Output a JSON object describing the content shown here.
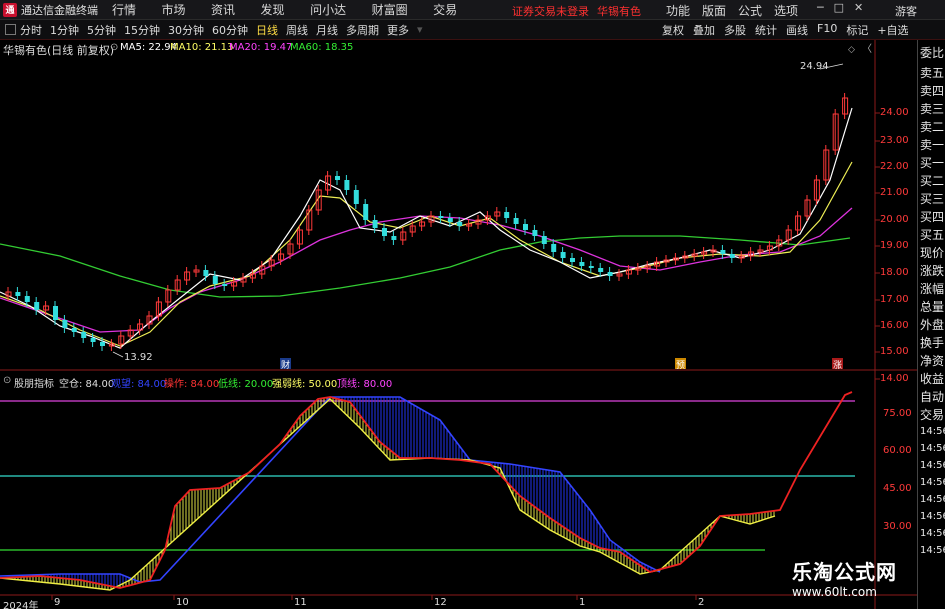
{
  "titlebar": {
    "app_title": "通达信金融终端",
    "menu": [
      "行情",
      "市场",
      "资讯",
      "发现",
      "问小达",
      "财富圈",
      "交易"
    ],
    "notice": "证券交易未登录",
    "stock": "华锡有色",
    "right_menu": [
      "功能",
      "版面",
      "公式",
      "选项"
    ],
    "guest": "游客"
  },
  "toolbar": {
    "periods": [
      "分时",
      "1分钟",
      "5分钟",
      "15分钟",
      "30分钟",
      "60分钟",
      "日线",
      "周线",
      "月线",
      "多周期",
      "更多"
    ],
    "active_period": "日线",
    "right_buttons": [
      "复权",
      "叠加",
      "多股",
      "统计",
      "画线",
      "F10",
      "标记",
      "+自选"
    ]
  },
  "main_chart": {
    "stock_label": "华锡有色(日线 前复权)",
    "ma": [
      {
        "label": "MA5: 22.94",
        "color": "#ffffff"
      },
      {
        "label": "MA10: 21.13",
        "color": "#ffff66"
      },
      {
        "label": "MA20: 19.47",
        "color": "#ff44ff"
      },
      {
        "label": "MA60: 18.35",
        "color": "#33ee33"
      }
    ],
    "high_label": "24.94",
    "low_label": "13.92",
    "y_ticks": [
      "24.00",
      "23.00",
      "22.00",
      "21.00",
      "20.00",
      "19.00",
      "18.00",
      "17.00",
      "16.00",
      "15.00",
      "14.00"
    ],
    "markers": [
      "财",
      "预",
      "涨"
    ]
  },
  "indicator": {
    "name": "股朋指标",
    "params": [
      {
        "label": "空仓: 84.00",
        "color": "#dddddd"
      },
      {
        "label": "观望: 84.00",
        "color": "#3344ff"
      },
      {
        "label": "操作: 84.00",
        "color": "#ff3333"
      },
      {
        "label": "低线: 20.00",
        "color": "#33ee33"
      },
      {
        "label": "强弱线: 50.00",
        "color": "#ffff66"
      },
      {
        "label": "顶线: 80.00",
        "color": "#ff44ff"
      }
    ],
    "y_ticks": [
      "75.00",
      "60.00",
      "45.00",
      "30.00"
    ]
  },
  "x_axis": [
    "2024年",
    "9",
    "10",
    "11",
    "12",
    "1",
    "2"
  ],
  "right_panel": [
    "委比",
    "卖五",
    "卖四",
    "卖三",
    "卖二",
    "卖一",
    "买一",
    "买二",
    "买三",
    "买四",
    "买五",
    "现价",
    "涨跌",
    "涨幅",
    "总量",
    "外盘",
    "换手",
    "净资",
    "收益",
    "自动",
    "交易",
    "14:56",
    "14:56",
    "14:56",
    "14:56",
    "14:56",
    "14:56",
    "14:56",
    "14:56"
  ],
  "watermark": {
    "title": "乐淘公式网",
    "url": "www.60lt.com"
  }
}
